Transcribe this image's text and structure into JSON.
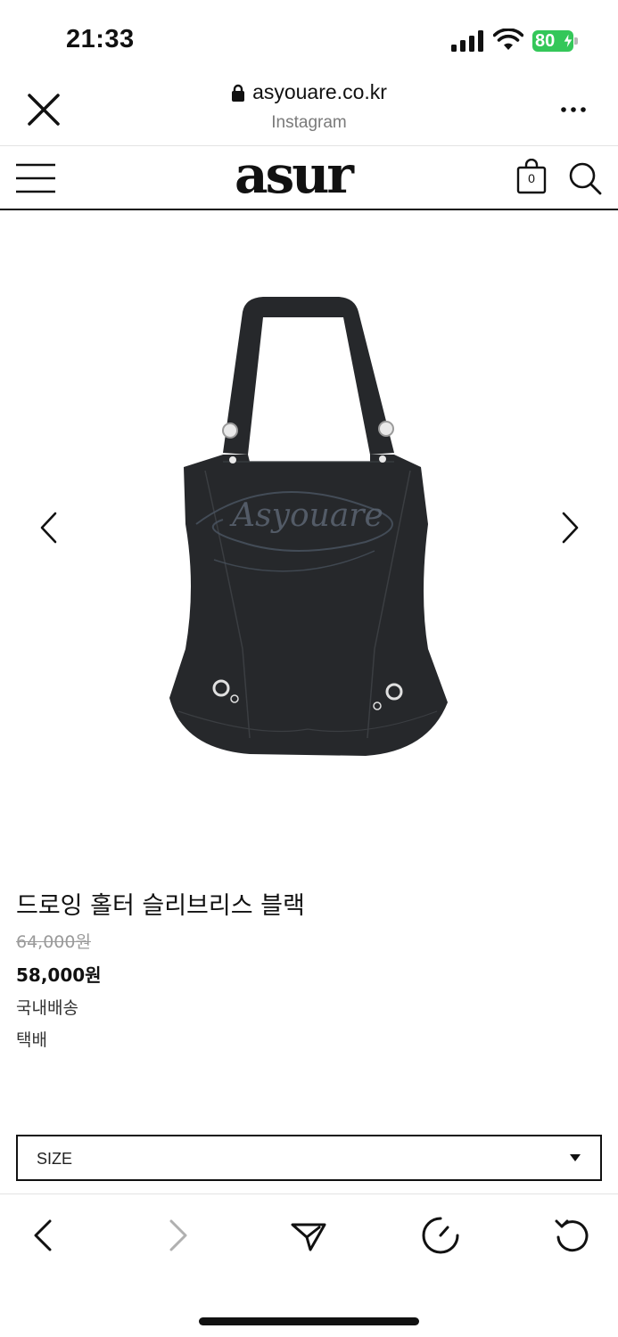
{
  "status_bar": {
    "time": "21:33",
    "battery": "80",
    "icons": [
      "signal-icon",
      "wifi-icon",
      "battery-icon"
    ]
  },
  "browser": {
    "url": "asyouare.co.kr",
    "source": "Instagram",
    "icons": [
      "close-icon",
      "lock-icon",
      "more-icon"
    ]
  },
  "site": {
    "logo": "asur",
    "cart_count": "0",
    "icons": [
      "menu-icon",
      "cart-icon",
      "search-icon"
    ]
  },
  "gallery": {
    "icons": [
      "chevron-left-icon",
      "chevron-right-icon"
    ],
    "image_watermark": "Asyouare"
  },
  "product": {
    "name": "드로잉 홀터 슬리브리스 블랙",
    "original_price": "64,000원",
    "sale_price": "58,000원",
    "shipping_region": "국내배송",
    "shipping_method": "택배"
  },
  "options": {
    "size_label": "SIZE"
  },
  "toolbar": {
    "icons": [
      "back-icon",
      "forward-icon",
      "share-icon",
      "history-icon",
      "reload-icon"
    ]
  },
  "colors": {
    "battery_green": "#34c759",
    "text_primary": "#111111",
    "text_muted": "#7a7a7a",
    "disabled_gray": "#b0b0b0",
    "garment": "#26282b"
  }
}
